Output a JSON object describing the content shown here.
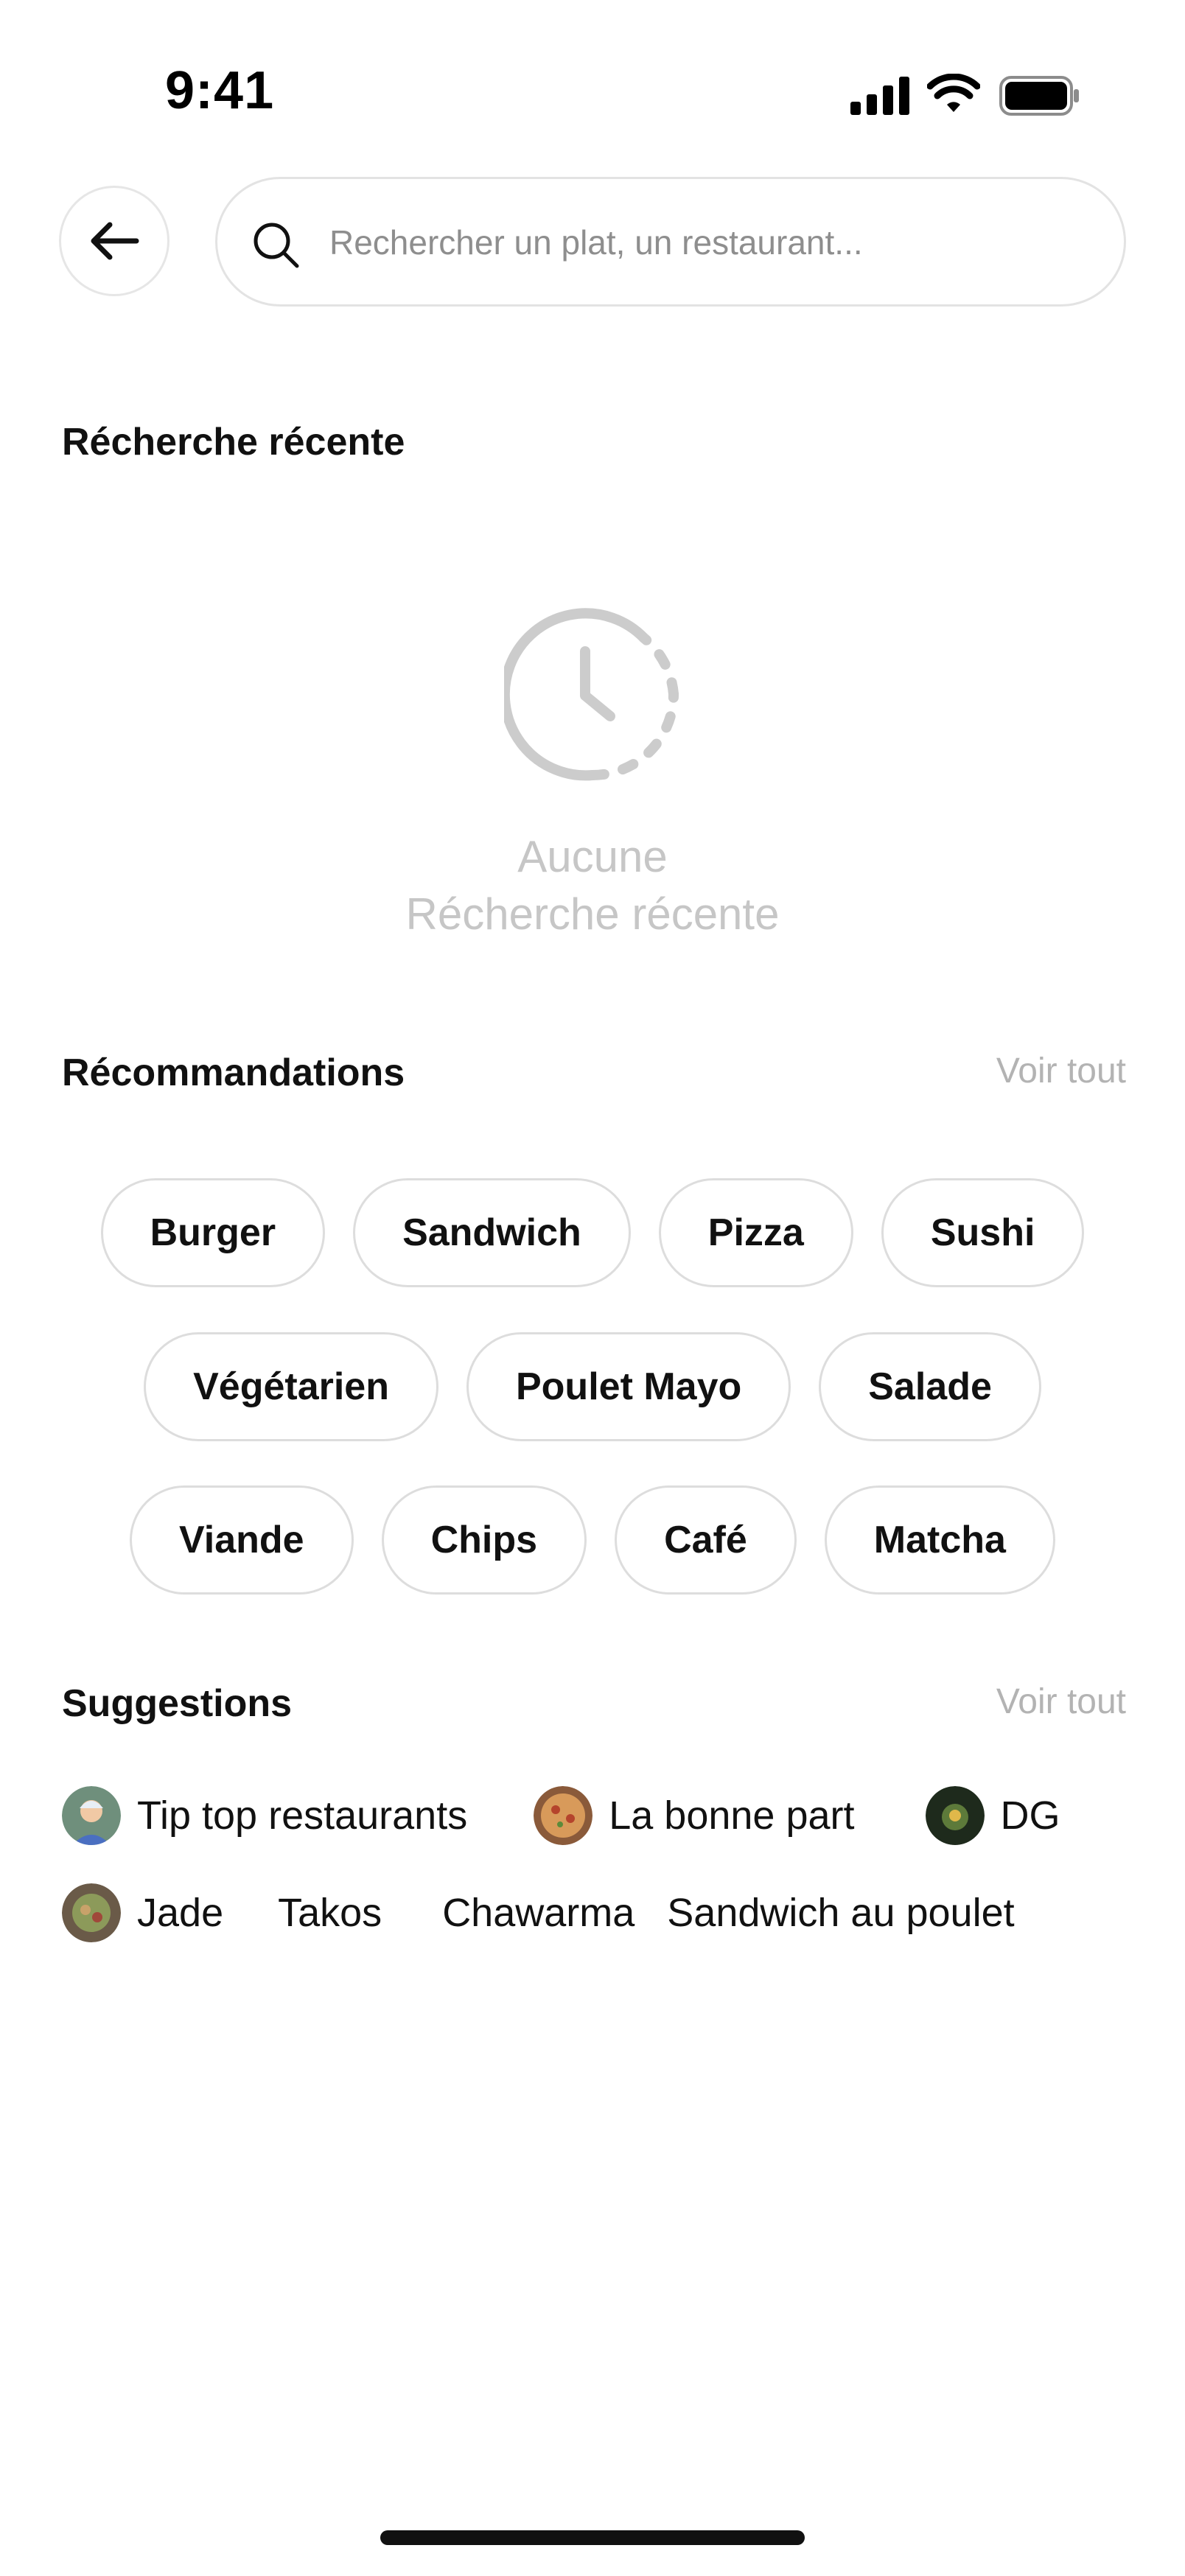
{
  "status_bar": {
    "time": "9:41"
  },
  "search": {
    "placeholder": "Rechercher un plat, un restaurant..."
  },
  "recent": {
    "title": "Récherche récente",
    "empty_line1": "Aucune",
    "empty_line2": "Récherche récente"
  },
  "recommendations": {
    "title": "Récommandations",
    "see_all": "Voir tout",
    "rows": [
      [
        "Burger",
        "Sandwich",
        "Pizza",
        "Sushi"
      ],
      [
        "Végétarien",
        "Poulet Mayo",
        "Salade"
      ],
      [
        "Viande",
        "Chips",
        "Café",
        "Matcha"
      ]
    ]
  },
  "suggestions": {
    "title": "Suggestions",
    "see_all": "Voir tout",
    "row1": [
      {
        "label": "Tip top restaurants",
        "icon": "user-avatar-icon"
      },
      {
        "label": "La bonne part",
        "icon": "pizza-avatar-icon"
      },
      {
        "label": "DG",
        "icon": "dish-avatar-icon"
      }
    ],
    "row2": [
      {
        "label": "Jade",
        "icon": "food-avatar-icon"
      },
      {
        "label": "Takos"
      },
      {
        "label": "Chawarma"
      },
      {
        "label": "Sandwich au poulet"
      }
    ]
  },
  "colors": {
    "accent_text": "#111111",
    "muted": "#b3b3b3",
    "border": "#dddddd"
  }
}
